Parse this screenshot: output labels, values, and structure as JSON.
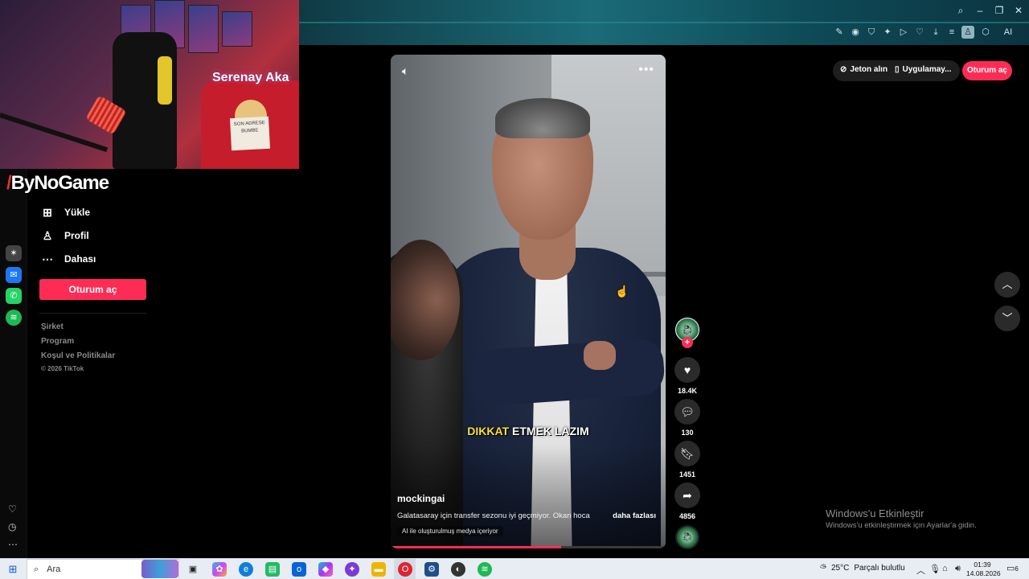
{
  "overlay": {
    "streamer_name": "Serenay Aka",
    "sign_text": "SON ADRESE BUMBE",
    "brand": "ByNoGame"
  },
  "browser": {
    "window_controls": [
      "⌕",
      "–",
      "❐",
      "✕"
    ],
    "toolbar_icons": [
      "edit-icon",
      "camera-icon",
      "shield-icon",
      "extensions-icon",
      "play-icon",
      "heart-icon",
      "download-icon",
      "menu-icon",
      "profile-icon",
      "cube-icon",
      "ai-icon"
    ],
    "ai_label": "AI"
  },
  "sidebar": {
    "items": [
      {
        "label": "Yükle",
        "icon": "plus-square-icon"
      },
      {
        "label": "Profil",
        "icon": "person-icon"
      },
      {
        "label": "Dahası",
        "icon": "more-icon"
      }
    ],
    "login_button": "Oturum aç",
    "links": [
      "Şirket",
      "Program",
      "Koşul ve Politikalar"
    ],
    "copyright": "© 2026 TikTok"
  },
  "header": {
    "coins": "Jeton alın",
    "app": "Uygulamay...",
    "login": "Oturum aç"
  },
  "video": {
    "caption_highlight": "DIKKAT",
    "caption_rest": "ETMEK LAZIM",
    "username": "mockingai",
    "description": "Galatasaray için transfer sezonu iyi geçmiyor. Okan hoca",
    "more": "daha fazlası",
    "ai_badge": "AI ile oluşturulmuş medya içeriyor",
    "progress": 0.62
  },
  "actions": {
    "likes": "18.4K",
    "comments": "130",
    "saves": "1451",
    "shares": "4856"
  },
  "watermark": {
    "title": "Windows'u Etkinleştir",
    "subtitle": "Windows'u etkinleştirmek için Ayarlar'a gidin."
  },
  "taskbar": {
    "search_placeholder": "Ara",
    "weather": "25°C",
    "weather_desc": "Parçalı bulutlu",
    "time": "01:39",
    "date": "14.08.2026",
    "notification_count": "6"
  },
  "colors": {
    "accent": "#fe2c55",
    "caption_highlight": "#f7e13b"
  }
}
